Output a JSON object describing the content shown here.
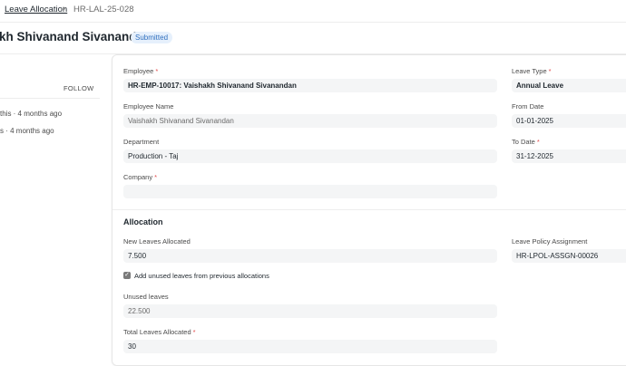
{
  "breadcrumb": {
    "parent": "Leave Allocation",
    "separator": "›",
    "current": "HR-LAL-25-028"
  },
  "header": {
    "title": "kh Shivanand Sivanandan",
    "status": "Submitted"
  },
  "sidebar": {
    "follow_label": "FOLLOW",
    "activity": [
      "this · 4 months ago",
      "s · 4 months ago"
    ]
  },
  "form": {
    "employee": {
      "label": "Employee",
      "value": "HR-EMP-10017: Vaishakh Shivanand Sivanandan"
    },
    "employee_name": {
      "label": "Employee Name",
      "value": "Vaishakh Shivanand Sivanandan"
    },
    "department": {
      "label": "Department",
      "value": "Production - Taj"
    },
    "company": {
      "label": "Company",
      "value": ""
    },
    "leave_type": {
      "label": "Leave Type",
      "value": "Annual Leave"
    },
    "from_date": {
      "label": "From Date",
      "value": "01-01-2025"
    },
    "to_date": {
      "label": "To Date",
      "value": "31-12-2025"
    }
  },
  "allocation": {
    "section_title": "Allocation",
    "new_leaves": {
      "label": "New Leaves Allocated",
      "value": "7.500"
    },
    "add_unused": {
      "label": "Add unused leaves from previous allocations",
      "checked": true
    },
    "unused_leaves": {
      "label": "Unused leaves",
      "value": "22.500"
    },
    "total_leaves": {
      "label": "Total Leaves Allocated",
      "value": "30"
    },
    "policy_assignment": {
      "label": "Leave Policy Assignment",
      "value": "HR-LPOL-ASSGN-00026"
    }
  },
  "colors": {
    "required_marker": "#e24c4c",
    "status_badge_text": "#2f6fbe",
    "status_badge_bg": "#e6f0fc",
    "field_bg": "#f4f5f6"
  }
}
